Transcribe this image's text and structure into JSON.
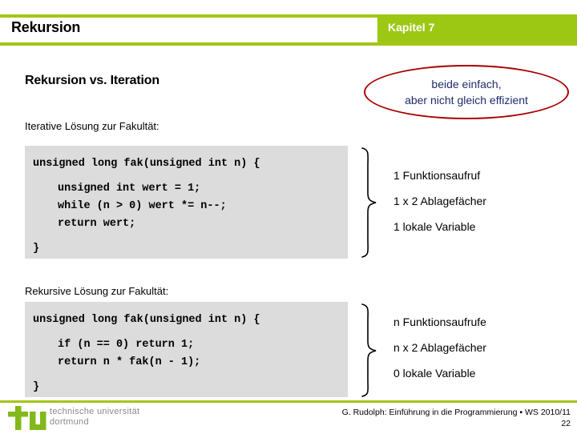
{
  "header": {
    "slide_title": "Rekursion",
    "chapter": "Kapitel 7",
    "green": "#9CC813",
    "rule_color": "#A2C617"
  },
  "content": {
    "section_heading": "Rekursion vs. Iteration",
    "iterative_label": "Iterative Lösung zur Fakultät:",
    "recursive_label": "Rekursive Lösung zur Fakultät:"
  },
  "callout": {
    "line_1": "beide einfach,",
    "line_2": "aber nicht gleich effizient",
    "border_color": "#AA0000",
    "text_color": "#1F2C6B"
  },
  "code_iterative": {
    "line_1": "unsigned long fak(unsigned int n) {",
    "line_2": "unsigned int wert = 1;",
    "line_3": "while (n > 0) wert *= n--;",
    "line_4": "return wert;",
    "line_5": "}",
    "background": "#DCDCDC"
  },
  "code_recursive": {
    "line_1": "unsigned long fak(unsigned int n) {",
    "line_2": "if (n == 0) return 1;",
    "line_3": "return n * fak(n - 1);",
    "line_4": "}",
    "background": "#DCDCDC"
  },
  "annotations_iterative": {
    "item_1": "1 Funktionsaufruf",
    "item_2": "1 x 2 Ablagefächer",
    "item_3": "1 lokale Variable"
  },
  "annotations_recursive": {
    "item_1": "n Funktionsaufrufe",
    "item_2": "n x 2 Ablagefächer",
    "item_3": "0 lokale Variable"
  },
  "footer": {
    "logo_line_1": "technische universität",
    "logo_line_2": "dortmund",
    "logo_color": "#83B81A",
    "credit": "G. Rudolph: Einführung in die Programmierung ▪ WS 2010/11",
    "page_number": "22"
  }
}
